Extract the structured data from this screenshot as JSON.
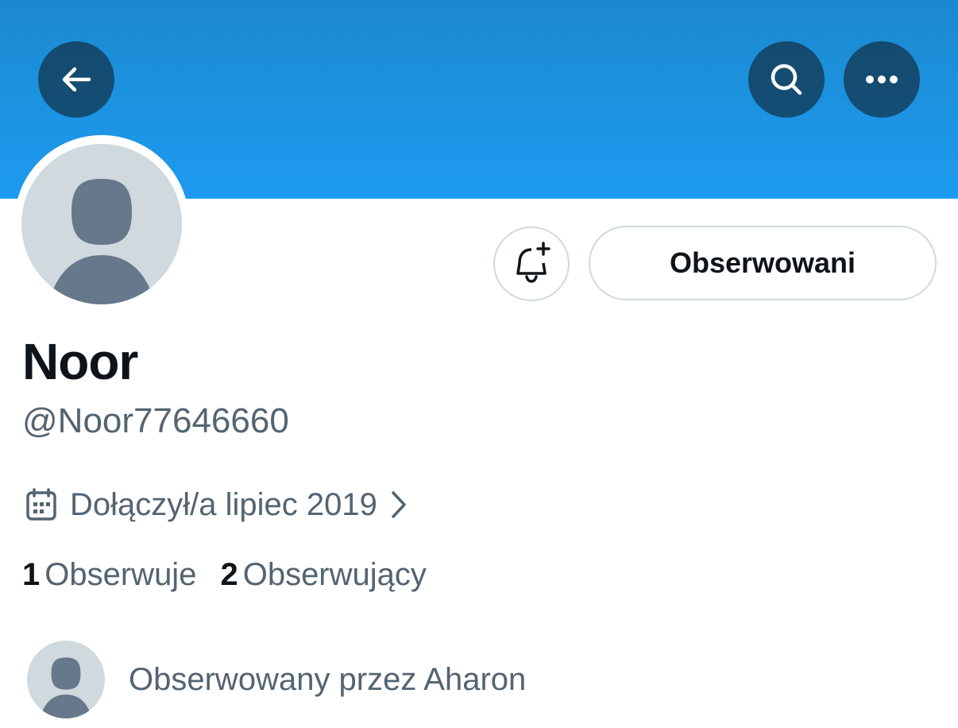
{
  "header": {
    "back_icon": "arrow-left-icon",
    "search_icon": "search-icon",
    "more_icon": "more-horizontal-icon",
    "banner_color": "#1d9bf0"
  },
  "profile": {
    "avatar_icon": "default-avatar",
    "display_name": "Noor",
    "handle": "@Noor77646660",
    "joined": "Dołączył/a lipiec 2019",
    "joined_icon": "calendar-icon"
  },
  "actions": {
    "notify_icon": "bell-plus-icon",
    "following_label": "Obserwowani"
  },
  "stats": {
    "following_count": "1",
    "following_label": "Obserwuje",
    "followers_count": "2",
    "followers_label": "Obserwujący"
  },
  "followed_by": {
    "text": "Obserwowany przez Aharon"
  }
}
